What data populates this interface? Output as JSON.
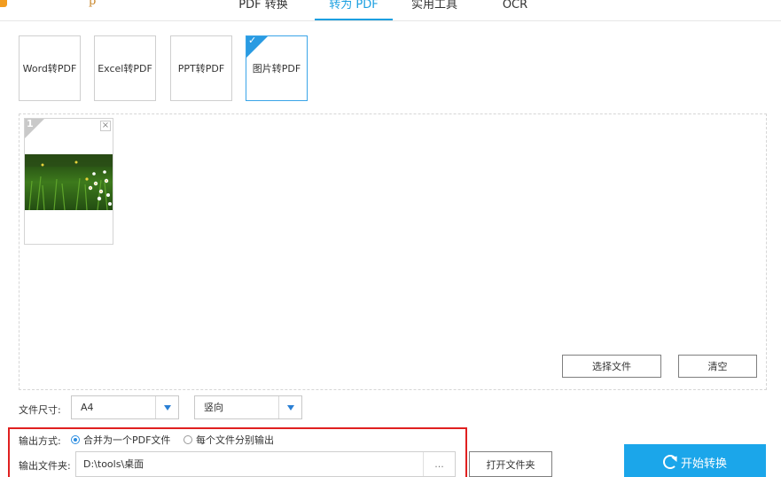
{
  "tabs": [
    {
      "label": "PDF 转换",
      "active": false
    },
    {
      "label": "转为 PDF",
      "active": true
    },
    {
      "label": "实用工具",
      "active": false
    },
    {
      "label": "OCR",
      "active": false
    }
  ],
  "logo_fragment": "p",
  "types": [
    {
      "label": "Word转PDF",
      "selected": false
    },
    {
      "label": "Excel转PDF",
      "selected": false
    },
    {
      "label": "PPT转PDF",
      "selected": false
    },
    {
      "label": "图片转PDF",
      "selected": true
    }
  ],
  "file_list": {
    "items": [
      {
        "index": "1",
        "close": "×"
      }
    ]
  },
  "actions": {
    "choose_file": "选择文件",
    "clear": "清空"
  },
  "settings": {
    "size_label": "文件尺寸:",
    "size_value": "A4",
    "orientation_value": "竖向",
    "output_mode_label": "输出方式:",
    "output_options": [
      {
        "label": "合并为一个PDF文件",
        "checked": true
      },
      {
        "label": "每个文件分别输出",
        "checked": false
      }
    ],
    "output_folder_label": "输出文件夹:",
    "output_folder_value": "D:\\tools\\桌面",
    "browse_label": "...",
    "open_folder_label": "打开文件夹"
  },
  "start_button": "开始转换",
  "colors": {
    "accent": "#1ba6ea",
    "highlight_box": "#e02020"
  }
}
